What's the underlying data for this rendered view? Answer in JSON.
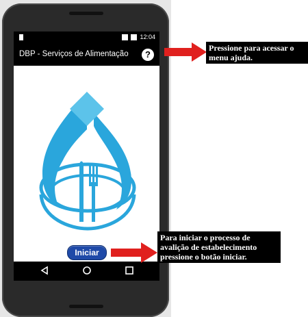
{
  "status": {
    "time": "12:04"
  },
  "app": {
    "title": "DBP - Serviços de Alimentação",
    "help_label": "?"
  },
  "main": {
    "start_label": "Iniciar"
  },
  "annotations": {
    "help": "Pressione para acessar o menu ajuda.",
    "start": "Para iniciar o processo de avalição de estabelecimento pressione o botão iniciar."
  },
  "colors": {
    "logo_blue": "#2aa6dc",
    "button_blue": "#1f4aa8",
    "arrow_red": "#e0201e"
  }
}
